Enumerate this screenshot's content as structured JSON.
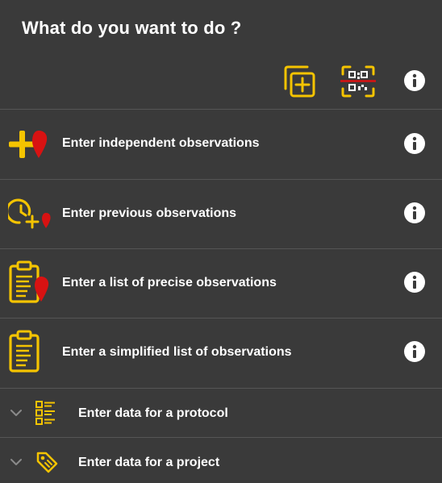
{
  "header": {
    "title": "What do you want to do ?"
  },
  "toolbar": {
    "icons": [
      "add-copy-icon",
      "qr-scan-icon",
      "info-icon"
    ]
  },
  "actions": [
    {
      "label": "Enter independent observations",
      "icon": "plus-marker-icon"
    },
    {
      "label": "Enter previous observations",
      "icon": "clock-plus-icon"
    },
    {
      "label": "Enter a list of precise observations",
      "icon": "clipboard-marker-icon"
    },
    {
      "label": "Enter a simplified list of observations",
      "icon": "clipboard-icon"
    }
  ],
  "expandable": [
    {
      "label": "Enter data for a protocol",
      "icon": "protocol-list-icon"
    },
    {
      "label": "Enter data for a project",
      "icon": "tag-icon"
    }
  ],
  "colors": {
    "background": "#3a3a3a",
    "accent": "#f5c400",
    "marker": "#d81212",
    "text": "#ffffff",
    "divider": "#555555"
  }
}
